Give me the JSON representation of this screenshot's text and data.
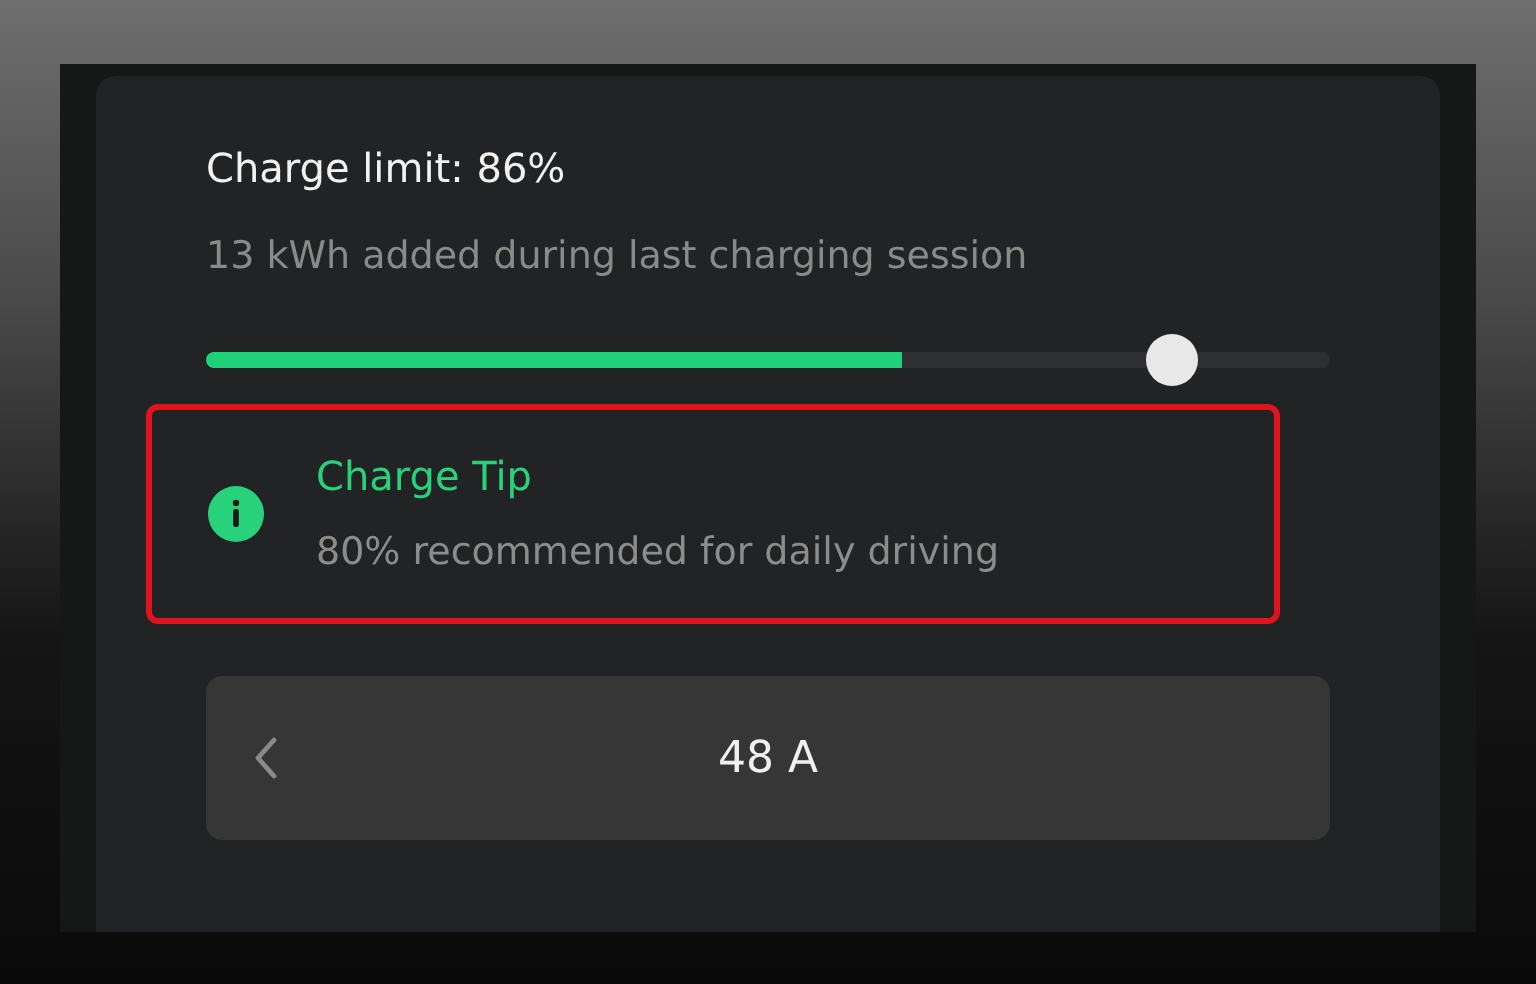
{
  "charge_limit": {
    "title": "Charge limit: 86%",
    "subtitle": "13 kWh added during last charging session"
  },
  "slider": {
    "charge_fill": {
      "level": 0.62
    },
    "limit_thumb": {
      "level": 0.86
    }
  },
  "tip": {
    "title": "Charge Tip",
    "text": "80% recommended for daily driving",
    "highlighted": true
  },
  "current_stepper": {
    "value": "48 A"
  }
}
